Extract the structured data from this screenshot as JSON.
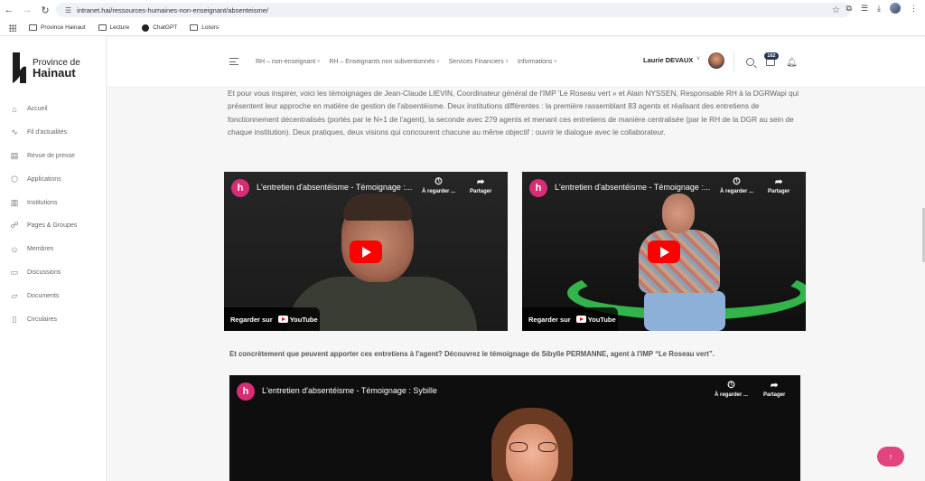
{
  "browser": {
    "url": "intranet.hai/ressources-humaines-non-enseignant/absenteisme/",
    "bookmarks": [
      "Province Hainaut",
      "Lecture",
      "ChatGPT",
      "Loisirs"
    ]
  },
  "logo": {
    "line1": "Province de",
    "line2": "Hainaut"
  },
  "sidebar": {
    "items": [
      {
        "label": "Accueil",
        "icon": "home-icon"
      },
      {
        "label": "Fil d'actualités",
        "icon": "activity-icon"
      },
      {
        "label": "Revue de presse",
        "icon": "newspaper-icon"
      },
      {
        "label": "Applications",
        "icon": "box-icon"
      },
      {
        "label": "Institutions",
        "icon": "building-icon"
      },
      {
        "label": "Pages & Groupes",
        "icon": "groups-icon"
      },
      {
        "label": "Membres",
        "icon": "user-icon"
      },
      {
        "label": "Discussions",
        "icon": "chat-icon"
      },
      {
        "label": "Documents",
        "icon": "folder-icon"
      },
      {
        "label": "Circulaires",
        "icon": "file-icon"
      }
    ]
  },
  "header": {
    "menu": [
      "RH – non-enseignant",
      "RH – Enseignants non subventionnés",
      "Services Financiers",
      "Informations"
    ],
    "user_name": "Laurie DEVAUX",
    "message_count": "162"
  },
  "content": {
    "intro": "Et pour vous inspirer, voici les témoignages de Jean-Claude LIEVIN, Coordinateur général de l'IMP 'Le Roseau vert » et Alain NYSSEN, Responsable RH à la DGRWapi qui présentent leur approche en matière de gestion de l'absentéisme. Deux institutions différentes : la première rassemblant 83 agents et réalisant des entretiens de fonctionnement décentralisés (portés par le N+1 de l'agent), la seconde avec 279 agents et menant ces entretiens de manière centralisée (par le RH de la DGR au sein de chaque institution). Deux pratiques, deux visions qui concourent chacune au même objectif : ouvrir le dialogue avec le collaborateur.",
    "videos": [
      {
        "title": "L'entretien d'absentéisme - Témoignage :...",
        "watch_later": "À regarder ...",
        "share": "Partager",
        "watch_on": "Regarder sur",
        "platform": "YouTube"
      },
      {
        "title": "L'entretien d'absentéisme - Témoignage :...",
        "watch_later": "À regarder ...",
        "share": "Partager",
        "watch_on": "Regarder sur",
        "platform": "YouTube"
      }
    ],
    "question": "Et concrètement que peuvent apporter ces entretiens à l'agent? Découvrez le témoignage de Sibylle PERMANNE, agent à l'IMP “Le Roseau vert”.",
    "video3": {
      "title": "L'entretien d'absentéisme - Témoignage : Sybille",
      "watch_later": "À regarder ...",
      "share": "Partager"
    }
  },
  "colors": {
    "accent": "#e2447f",
    "badge": "#243755",
    "youtube": "#ff0000"
  }
}
